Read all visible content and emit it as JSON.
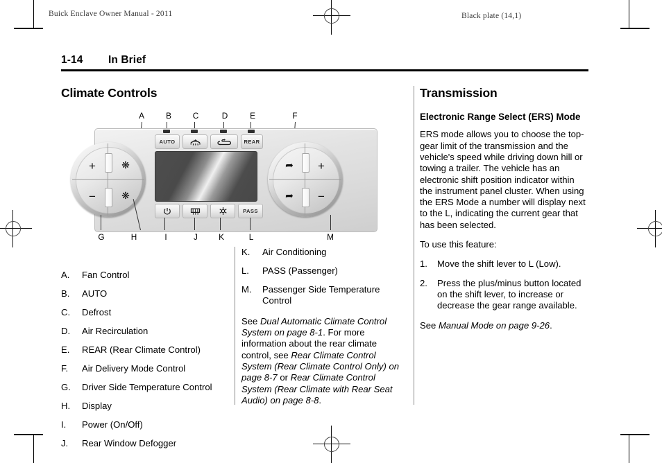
{
  "header": {
    "doc_title": "Buick Enclave Owner Manual - 2011",
    "plate_label": "Black plate (14,1)"
  },
  "page": {
    "number": "1-14",
    "chapter": "In Brief"
  },
  "left_column": {
    "section_title": "Climate Controls",
    "figure": {
      "name": "climate-control-panel",
      "top_callouts": [
        "A",
        "B",
        "C",
        "D",
        "E",
        "F"
      ],
      "bottom_callouts": [
        "G",
        "H",
        "I",
        "J",
        "K",
        "L",
        "M"
      ],
      "buttons_top": [
        {
          "id": "auto",
          "label": "AUTO",
          "icon": "text"
        },
        {
          "id": "defrost",
          "label": "",
          "icon": "windshield-defrost-icon"
        },
        {
          "id": "recirculation",
          "label": "",
          "icon": "air-recirculation-icon"
        },
        {
          "id": "rear",
          "label": "REAR",
          "icon": "text"
        }
      ],
      "buttons_bottom": [
        {
          "id": "power",
          "label": "",
          "icon": "power-icon"
        },
        {
          "id": "rear-defogger",
          "label": "",
          "icon": "rear-defogger-icon"
        },
        {
          "id": "air-conditioning",
          "label": "",
          "icon": "ac-snowflake-icon"
        },
        {
          "id": "pass",
          "label": "PASS",
          "icon": "text"
        }
      ],
      "left_dial": {
        "name": "driver-temperature-dial",
        "glyphs": [
          "+",
          "−",
          "fan-icon",
          "fan-icon"
        ]
      },
      "right_dial": {
        "name": "passenger-temperature-dial",
        "glyphs": [
          "+",
          "−",
          "airflow-icon",
          "airflow-icon"
        ]
      },
      "display": {
        "name": "climate-display-screen"
      }
    },
    "items": [
      {
        "key": "A.",
        "text": "Fan Control"
      },
      {
        "key": "B.",
        "text": "AUTO"
      },
      {
        "key": "C.",
        "text": "Defrost"
      },
      {
        "key": "D.",
        "text": "Air Recirculation"
      },
      {
        "key": "E.",
        "text": "REAR (Rear Climate Control)"
      },
      {
        "key": "F.",
        "text": "Air Delivery Mode Control"
      },
      {
        "key": "G.",
        "text": "Driver Side Temperature Control"
      },
      {
        "key": "H.",
        "text": "Display"
      },
      {
        "key": "I.",
        "text": "Power (On/Off)"
      },
      {
        "key": "J.",
        "text": "Rear Window Defogger"
      }
    ]
  },
  "middle_column": {
    "items": [
      {
        "key": "K.",
        "text": "Air Conditioning"
      },
      {
        "key": "L.",
        "text": "PASS (Passenger)"
      },
      {
        "key": "M.",
        "text": "Passenger Side Temperature Control"
      }
    ],
    "cross_reference": {
      "lead_1": "See ",
      "italic_1": "Dual Automatic Climate Control System on page 8-1",
      "plain_1": ". For more information about the rear climate control, see ",
      "italic_2": "Rear Climate Control System (Rear Climate Control Only) on page 8-7",
      "plain_2": " or ",
      "italic_3": "Rear Climate Control System (Rear Climate with Rear Seat Audio) on page 8-8",
      "plain_3": "."
    }
  },
  "right_column": {
    "section_title": "Transmission",
    "subsection_title": "Electronic Range Select (ERS) Mode",
    "paragraph_1": "ERS mode allows you to choose the top-gear limit of the transmission and the vehicle's speed while driving down hill or towing a trailer. The vehicle has an electronic shift position indicator within the instrument panel cluster. When using the ERS Mode a number will display next to the L, indicating the current gear that has been selected.",
    "paragraph_2": "To use this feature:",
    "steps": [
      {
        "key": "1.",
        "text": "Move the shift lever to L (Low)."
      },
      {
        "key": "2.",
        "text": "Press the plus/minus button located on the shift lever, to increase or decrease the gear range available."
      }
    ],
    "cross_reference": {
      "lead": "See ",
      "italic": "Manual Mode on page 9-26",
      "tail": "."
    }
  },
  "colors": {
    "text": "#000000",
    "header_text": "#3a3a3a",
    "rule": "#000000",
    "divider": "#8a8a8a"
  }
}
